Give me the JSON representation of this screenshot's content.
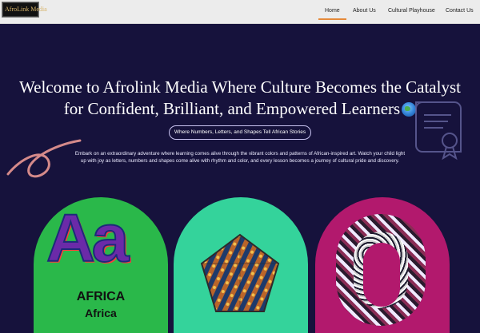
{
  "nav": {
    "logo_text": "AfroLink Media",
    "items": [
      {
        "label": "Home",
        "active": true
      },
      {
        "label": "About Us"
      },
      {
        "label": "Cultural Playhouse"
      },
      {
        "label": "Contact Us"
      }
    ]
  },
  "hero": {
    "title_line1": "Welcome to Afrolink Media Where Culture Becomes the Catalyst",
    "title_line2": "for Confident, Brilliant, and Empowered Learners",
    "pill_text": "Where Numbers, Letters, and Shapes Tell African Stories",
    "description": "Embark on an extraordinary adventure where learning comes alive through the vibrant colors and patterns of African-inspired art. Watch your child light up with joy as letters, numbers and shapes come alive with rhythm and color, and every lesson becomes a journey of cultural pride and discovery."
  },
  "cards": {
    "letters": {
      "glyphs": "Aa",
      "line1": "AFRICA",
      "line2": "Africa"
    },
    "number": {
      "glyph": "0"
    }
  },
  "colors": {
    "background": "#16123c",
    "nav_background": "#ececec",
    "accent": "#e58a3a",
    "card_green": "#2ab84a",
    "card_teal": "#34d39b",
    "card_magenta": "#b2196d"
  },
  "icons": [
    "globe-icon",
    "squiggle-decoration",
    "certificate-icon"
  ]
}
